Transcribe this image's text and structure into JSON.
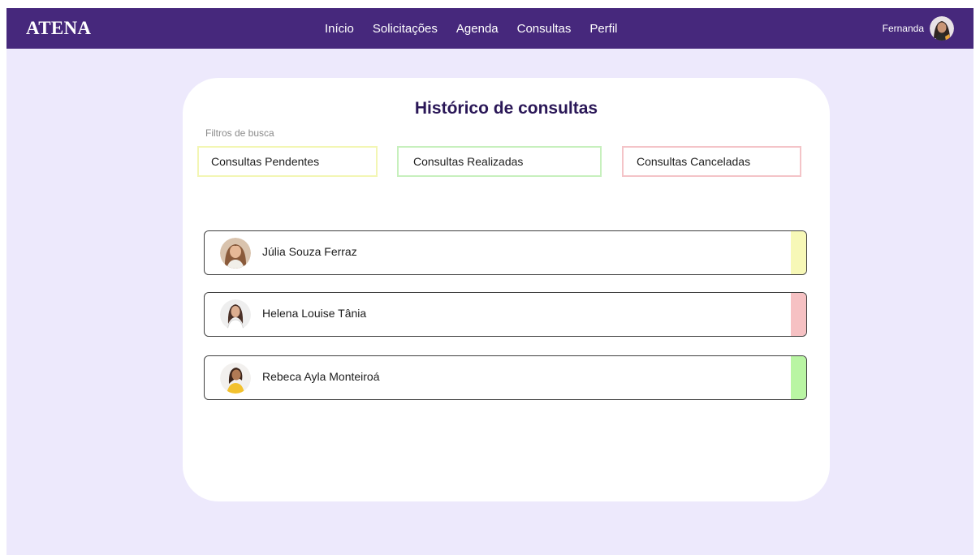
{
  "navbar": {
    "brand": "ATENA",
    "links": [
      {
        "label": "Início"
      },
      {
        "label": "Solicitações"
      },
      {
        "label": "Agenda"
      },
      {
        "label": "Consultas"
      },
      {
        "label": "Perfil"
      }
    ],
    "user": {
      "name": "Fernanda",
      "avatar_icon": "user-avatar"
    }
  },
  "page": {
    "title": "Histórico de consultas",
    "filters_label": "Filtros de busca",
    "filters": [
      {
        "label": "Consultas Pendentes",
        "color": "#f3f6b4"
      },
      {
        "label": "Consultas Realizadas",
        "color": "#c7f0bd"
      },
      {
        "label": "Consultas Canceladas",
        "color": "#f4c4c8"
      }
    ]
  },
  "consultations": [
    {
      "name": "Júlia Souza Ferraz",
      "status": "pendente",
      "status_color": "#f7f8b7"
    },
    {
      "name": "Helena Louise Tânia",
      "status": "cancelada",
      "status_color": "#f6c1c3"
    },
    {
      "name": "Rebeca Ayla Monteiroá",
      "status": "realizada",
      "status_color": "#b9f5a3"
    }
  ],
  "colors": {
    "navbar_bg": "#46287c",
    "page_bg": "#ede9fc",
    "title": "#2a1757"
  }
}
